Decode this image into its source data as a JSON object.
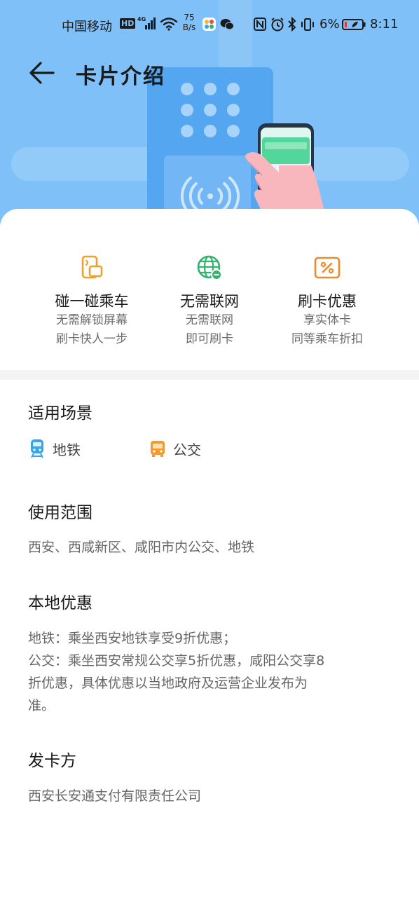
{
  "status_bar": {
    "carrier": "中国移动",
    "hd_label": "HD",
    "network": "4G",
    "speed_value": "75",
    "speed_unit": "B/s",
    "battery_percent": "6%",
    "time": "8:11"
  },
  "header": {
    "title": "卡片介绍"
  },
  "features": [
    {
      "title": "碰一碰乘车",
      "desc_line1": "无需解锁屏幕",
      "desc_line2": "刷卡快人一步",
      "icon": "tap-card-icon",
      "color": "#f0a12b"
    },
    {
      "title": "无需联网",
      "desc_line1": "无需联网",
      "desc_line2": "即可刷卡",
      "icon": "globe-icon",
      "color": "#33b36b"
    },
    {
      "title": "刷卡优惠",
      "desc_line1": "享实体卡",
      "desc_line2": "同等乘车折扣",
      "icon": "discount-icon",
      "color": "#f08a2b"
    }
  ],
  "scenes": {
    "title": "适用场景",
    "items": [
      {
        "label": "地铁",
        "icon": "metro-icon",
        "color": "#3aa6e8"
      },
      {
        "label": "公交",
        "icon": "bus-icon",
        "color": "#f39a2e"
      }
    ]
  },
  "scope": {
    "title": "使用范围",
    "text": "西安、西咸新区、咸阳市内公交、地铁"
  },
  "discount": {
    "title": "本地优惠",
    "line1": "地铁：乘坐西安地铁享受9折优惠；",
    "line2": "公交：乘坐西安常规公交享5折优惠，咸阳公交享8",
    "line3": "折优惠，具体优惠以当地政府及运营企业发布为",
    "line4": "准。"
  },
  "issuer": {
    "title": "发卡方",
    "text": "西安长安通支付有限责任公司"
  },
  "colors": {
    "hero_bg": "#7ec0f7",
    "text_primary": "#1a1a1a",
    "text_secondary": "#666666"
  }
}
